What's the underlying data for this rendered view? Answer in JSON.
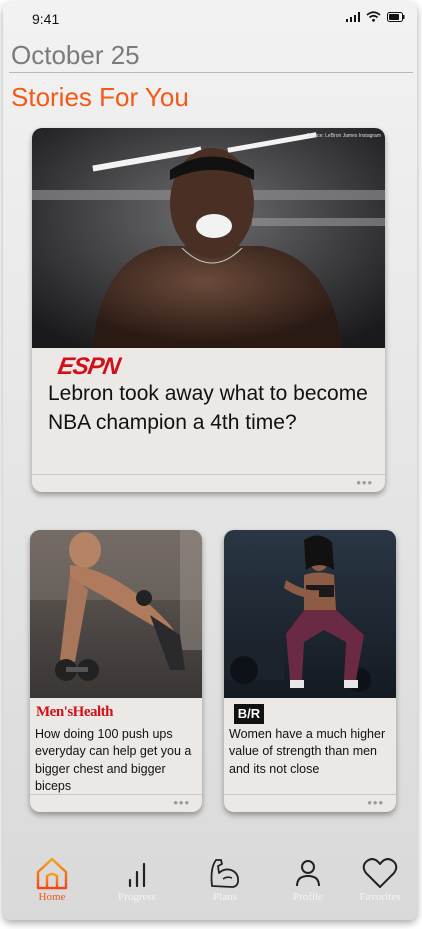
{
  "status": {
    "time": "9:41"
  },
  "header": {
    "date": "October 25",
    "section_title": "Stories For You"
  },
  "featured": {
    "source": "ESPN",
    "image_credit": "Source: LeBron James Instagram",
    "headline": "Lebron took away what to become NBA champion a 4th time?",
    "more": "•••"
  },
  "stories": [
    {
      "source": "Men'sHealth",
      "headline": "How doing 100 push ups everyday can help get you a bigger chest and bigger biceps",
      "more": "•••"
    },
    {
      "source": "B/R",
      "headline": "Women have a much higher value of strength than men and its not close",
      "more": "•••"
    }
  ],
  "tabs": [
    {
      "label": "Home",
      "icon": "home-icon",
      "active": true
    },
    {
      "label": "Progress",
      "icon": "bar-chart-icon",
      "active": false
    },
    {
      "label": "Plans",
      "icon": "flexed-arm-icon",
      "active": false
    },
    {
      "label": "Profile",
      "icon": "person-icon",
      "active": false
    },
    {
      "label": "Favorites",
      "icon": "heart-icon",
      "active": false
    }
  ],
  "colors": {
    "accent": "#f25a16",
    "date_text": "#7b7b7b",
    "card_bg": "#ece8e5"
  }
}
